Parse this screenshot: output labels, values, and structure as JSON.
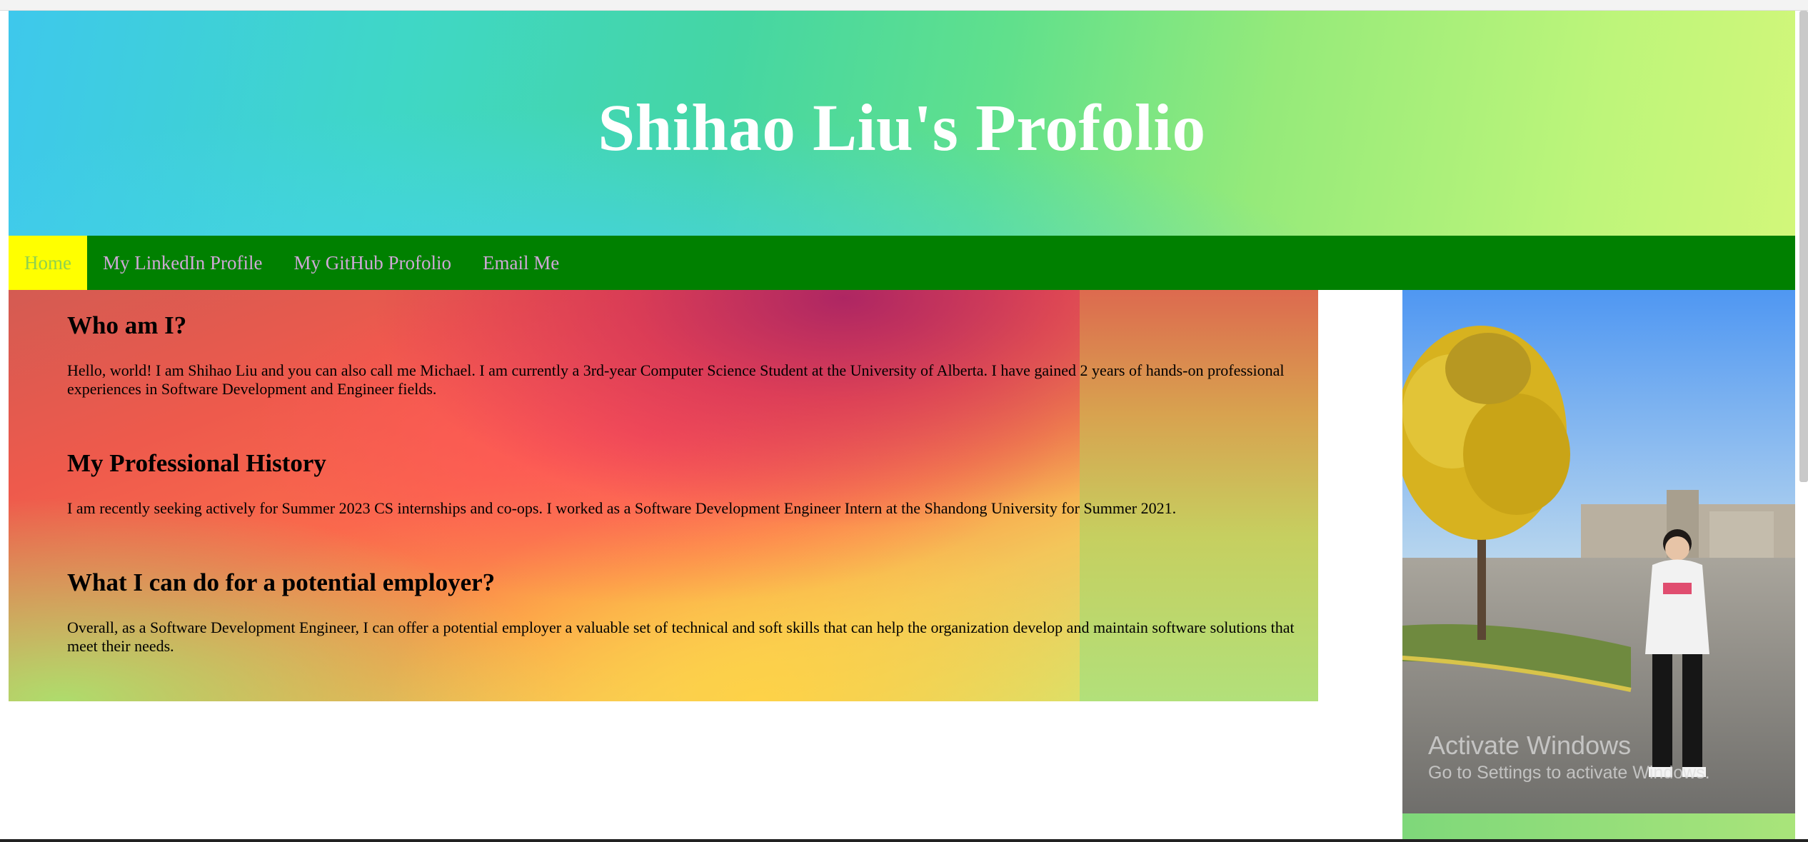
{
  "header": {
    "title": "Shihao Liu's Profolio"
  },
  "nav": {
    "items": [
      {
        "label": "Home",
        "active": true
      },
      {
        "label": "My LinkedIn Profile",
        "active": false
      },
      {
        "label": "My GitHub Profolio",
        "active": false
      },
      {
        "label": "Email Me",
        "active": false
      }
    ]
  },
  "sections": [
    {
      "heading": "Who am I?",
      "text": "Hello, world! I am Shihao Liu and you can also call me Michael. I am currently a 3rd-year Computer Science Student at the University of Alberta. I have gained 2 years of hands-on professional experiences in Software Development and Engineer fields."
    },
    {
      "heading": "My Professional History",
      "text": "I am recently seeking actively for Summer 2023 CS internships and co-ops. I worked as a Software Development Engineer Intern at the Shandong University for Summer 2021."
    },
    {
      "heading": "What I can do for a potential employer?",
      "text": "Overall, as a Software Development Engineer, I can offer a potential employer a valuable set of technical and soft skills that can help the organization develop and maintain software solutions that meet their needs."
    }
  ],
  "watermark": {
    "title": "Activate Windows",
    "subtitle": "Go to Settings to activate Windows."
  },
  "colors": {
    "nav_background": "#008000",
    "nav_active_background": "#ffff00",
    "nav_text": "#cfa8d6",
    "title_text": "#ffffff"
  }
}
